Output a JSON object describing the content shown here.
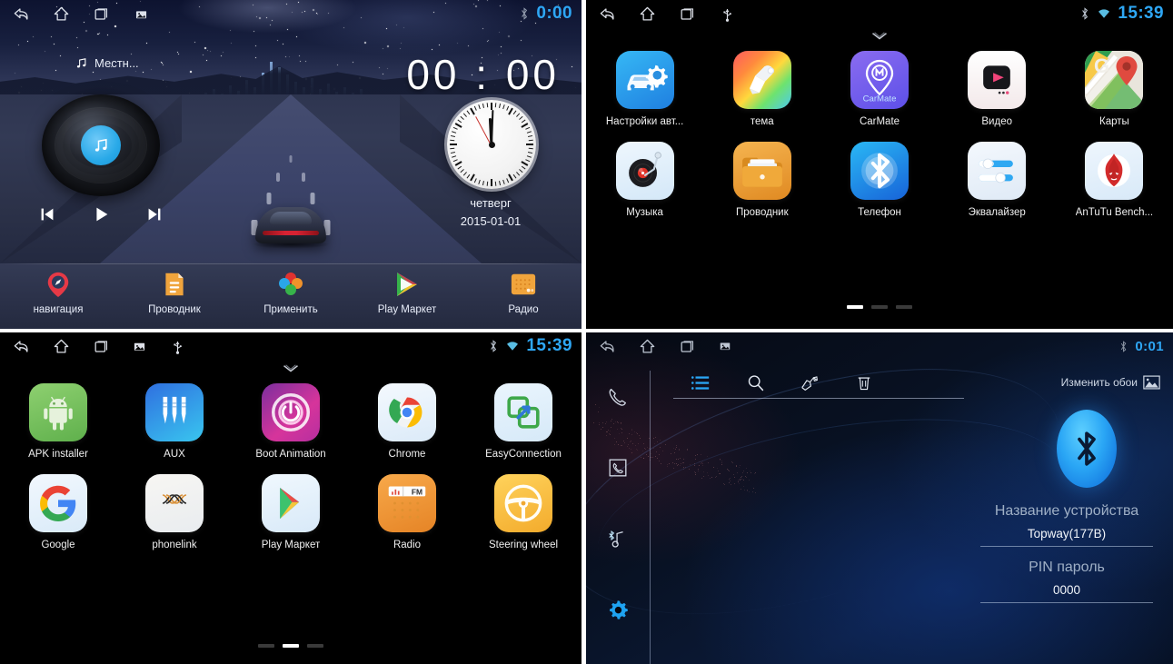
{
  "panels": {
    "home": {
      "statusbar": {
        "icons": [
          "back-icon",
          "home-icon",
          "recents-icon",
          "screenshot-icon"
        ],
        "right_icons": [
          "bluetooth-icon"
        ],
        "clock": "0:00"
      },
      "music_source_label": "Местн...",
      "big_clock": "00 : 00",
      "weekday": "четверг",
      "date": "2015-01-01",
      "transport": [
        "prev-track-button",
        "play-button",
        "next-track-button"
      ],
      "dock": [
        {
          "label": "навигация",
          "icon": "navigation-pin-icon"
        },
        {
          "label": "Проводник",
          "icon": "file-manager-icon"
        },
        {
          "label": "Применить",
          "icon": "apply-flower-icon"
        },
        {
          "label": "Play Маркет",
          "icon": "play-store-icon"
        },
        {
          "label": "Радио",
          "icon": "radio-icon"
        }
      ]
    },
    "drawer_page1": {
      "statusbar": {
        "icons": [
          "back-icon",
          "home-icon",
          "recents-icon",
          "usb-icon"
        ],
        "right_icons": [
          "bluetooth-icon",
          "wifi-icon"
        ],
        "clock": "15:39"
      },
      "apps": [
        {
          "label": "Настройки авт...",
          "icon": "car-settings-icon"
        },
        {
          "label": "тема",
          "icon": "theme-brush-icon"
        },
        {
          "label": "CarMate",
          "icon": "carmate-icon"
        },
        {
          "label": "Видео",
          "icon": "video-player-icon"
        },
        {
          "label": "Карты",
          "icon": "google-maps-icon"
        },
        {
          "label": "Музыка",
          "icon": "music-turntable-icon"
        },
        {
          "label": "Проводник",
          "icon": "file-explorer-icon"
        },
        {
          "label": "Телефон",
          "icon": "bluetooth-phone-icon"
        },
        {
          "label": "Эквалайзер",
          "icon": "equalizer-icon"
        },
        {
          "label": "AnTuTu Bench...",
          "icon": "antutu-icon"
        }
      ],
      "pages": 3,
      "active_page": 1
    },
    "drawer_page2": {
      "statusbar": {
        "icons": [
          "back-icon",
          "home-icon",
          "recents-icon",
          "screenshot-icon",
          "usb-icon"
        ],
        "right_icons": [
          "bluetooth-icon",
          "wifi-icon"
        ],
        "clock": "15:39"
      },
      "apps": [
        {
          "label": "APK installer",
          "icon": "android-robot-icon"
        },
        {
          "label": "AUX",
          "icon": "aux-jack-icon"
        },
        {
          "label": "Boot Animation",
          "icon": "power-ring-icon"
        },
        {
          "label": "Chrome",
          "icon": "chrome-icon"
        },
        {
          "label": "EasyConnection",
          "icon": "easyconnection-icon"
        },
        {
          "label": "Google",
          "icon": "google-g-icon"
        },
        {
          "label": "phonelink",
          "icon": "phonelink-xx-icon"
        },
        {
          "label": "Play Маркет",
          "icon": "play-store-icon"
        },
        {
          "label": "Radio",
          "icon": "fm-radio-icon"
        },
        {
          "label": "Steering wheel",
          "icon": "steering-wheel-icon"
        }
      ],
      "pages": 3,
      "active_page": 2
    },
    "bluetooth": {
      "statusbar": {
        "icons": [
          "back-icon",
          "home-icon",
          "recents-icon",
          "screenshot-icon"
        ],
        "right_icons": [
          "bluetooth-icon"
        ],
        "clock": "0:01"
      },
      "sidebar": [
        {
          "icon": "dialpad-call-icon"
        },
        {
          "icon": "contacts-book-icon"
        },
        {
          "icon": "bluetooth-music-icon"
        },
        {
          "icon": "settings-gear-icon",
          "active": true
        }
      ],
      "toolbar": [
        {
          "icon": "list-icon",
          "active": true
        },
        {
          "icon": "search-icon"
        },
        {
          "icon": "hand-pair-icon"
        },
        {
          "icon": "trash-icon"
        }
      ],
      "wallpaper_button": "Изменить обои",
      "wallpaper_icon": "image-icon",
      "device_name_label": "Название устройства",
      "device_name_value": "Topway(177B)",
      "pin_label": "PIN пароль",
      "pin_value": "0000"
    }
  },
  "colors": {
    "accent_blue": "#2ea7f5",
    "bt_blue": "#2aa6f5",
    "dock_bg": "#2b3149"
  }
}
